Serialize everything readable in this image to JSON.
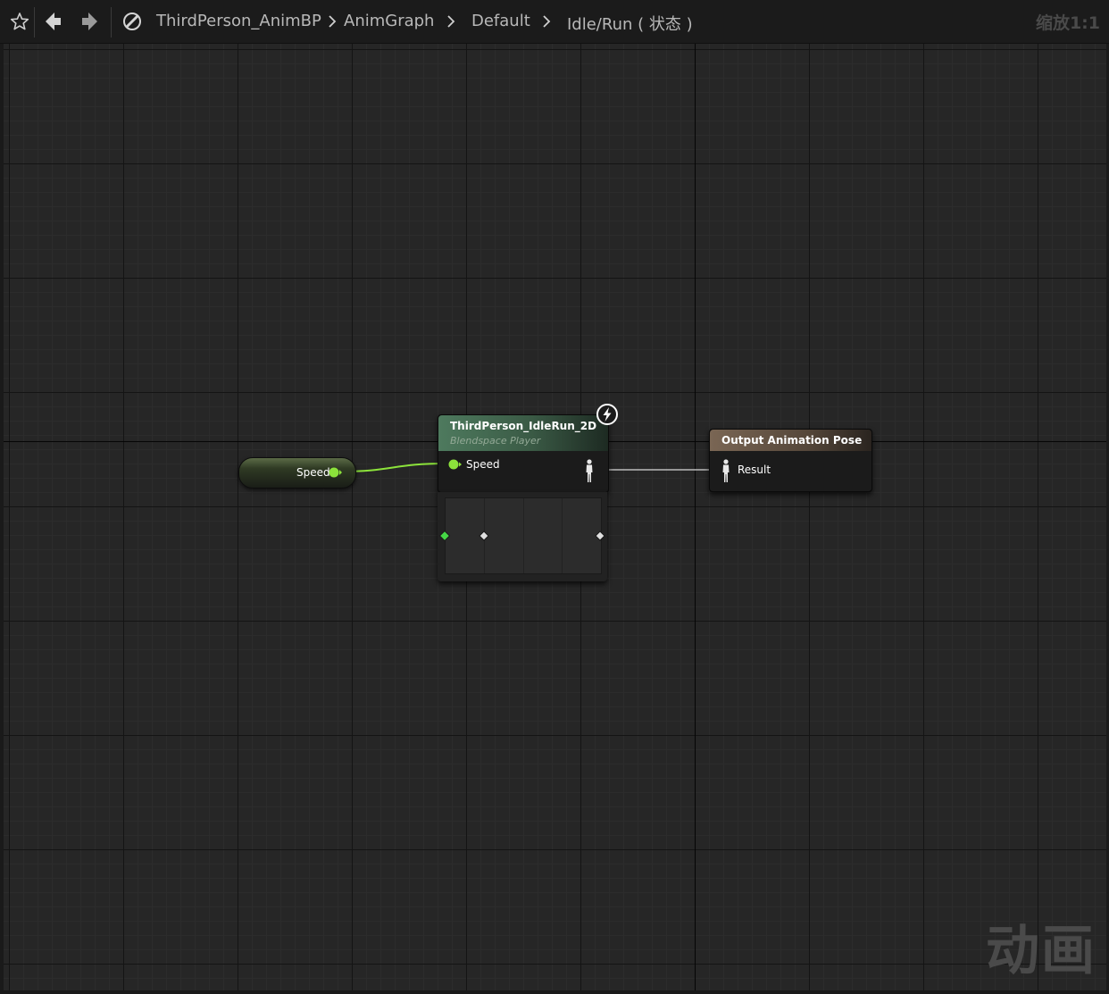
{
  "toolbar": {
    "icons": [
      "star-icon",
      "back-arrow-icon",
      "forward-arrow-icon",
      "blueprint-icon"
    ],
    "breadcrumbs": [
      "ThirdPerson_AnimBP",
      "AnimGraph",
      "Default",
      "Idle/Run ( 状态 )"
    ],
    "zoom": "缩放1:1"
  },
  "nodes": {
    "speed_variable": {
      "label": "Speed"
    },
    "blendspace_player": {
      "title": "ThirdPerson_IdleRun_2D",
      "subtitle": "Blendspace Player",
      "input_pin": "Speed",
      "badge_icon": "lightning-icon"
    },
    "output_pose": {
      "title": "Output Animation Pose",
      "input_pin": "Result"
    }
  },
  "watermark": "动画",
  "colors": {
    "float_pin": "#8ce33b",
    "pose_wire": "#bcbcbc",
    "blendspace_header": "#4e7a5e",
    "output_header": "#7a6654",
    "background": "#262626"
  }
}
